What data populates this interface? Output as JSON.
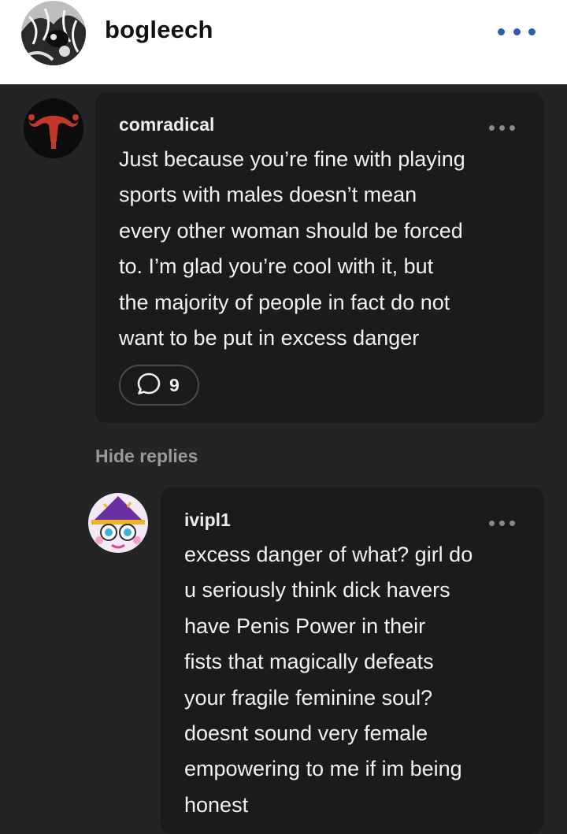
{
  "header": {
    "username": "bogleech",
    "more_icon": "ellipsis-icon",
    "accent_color": "#2b5fa8"
  },
  "comments": [
    {
      "author": "comradical",
      "lines": [
        "Just because you’re fine with playing",
        "sports with males doesn’t mean",
        "every other woman should be forced",
        "to. I’m glad you’re cool with it, but",
        "the majority of people in fact do not",
        "want to be put in excess danger"
      ],
      "reply_icon": "speech-bubble-icon",
      "reply_count": "9"
    }
  ],
  "hide_replies_label": "Hide replies",
  "replies": [
    {
      "author": "ivipl1",
      "lines": [
        "excess danger of what? girl do",
        "u seriously think dick havers",
        "have Penis Power in their",
        "fists that magically defeats",
        "your fragile feminine soul?",
        "doesnt sound very female",
        "empowering to me if im being",
        "honest"
      ]
    }
  ]
}
